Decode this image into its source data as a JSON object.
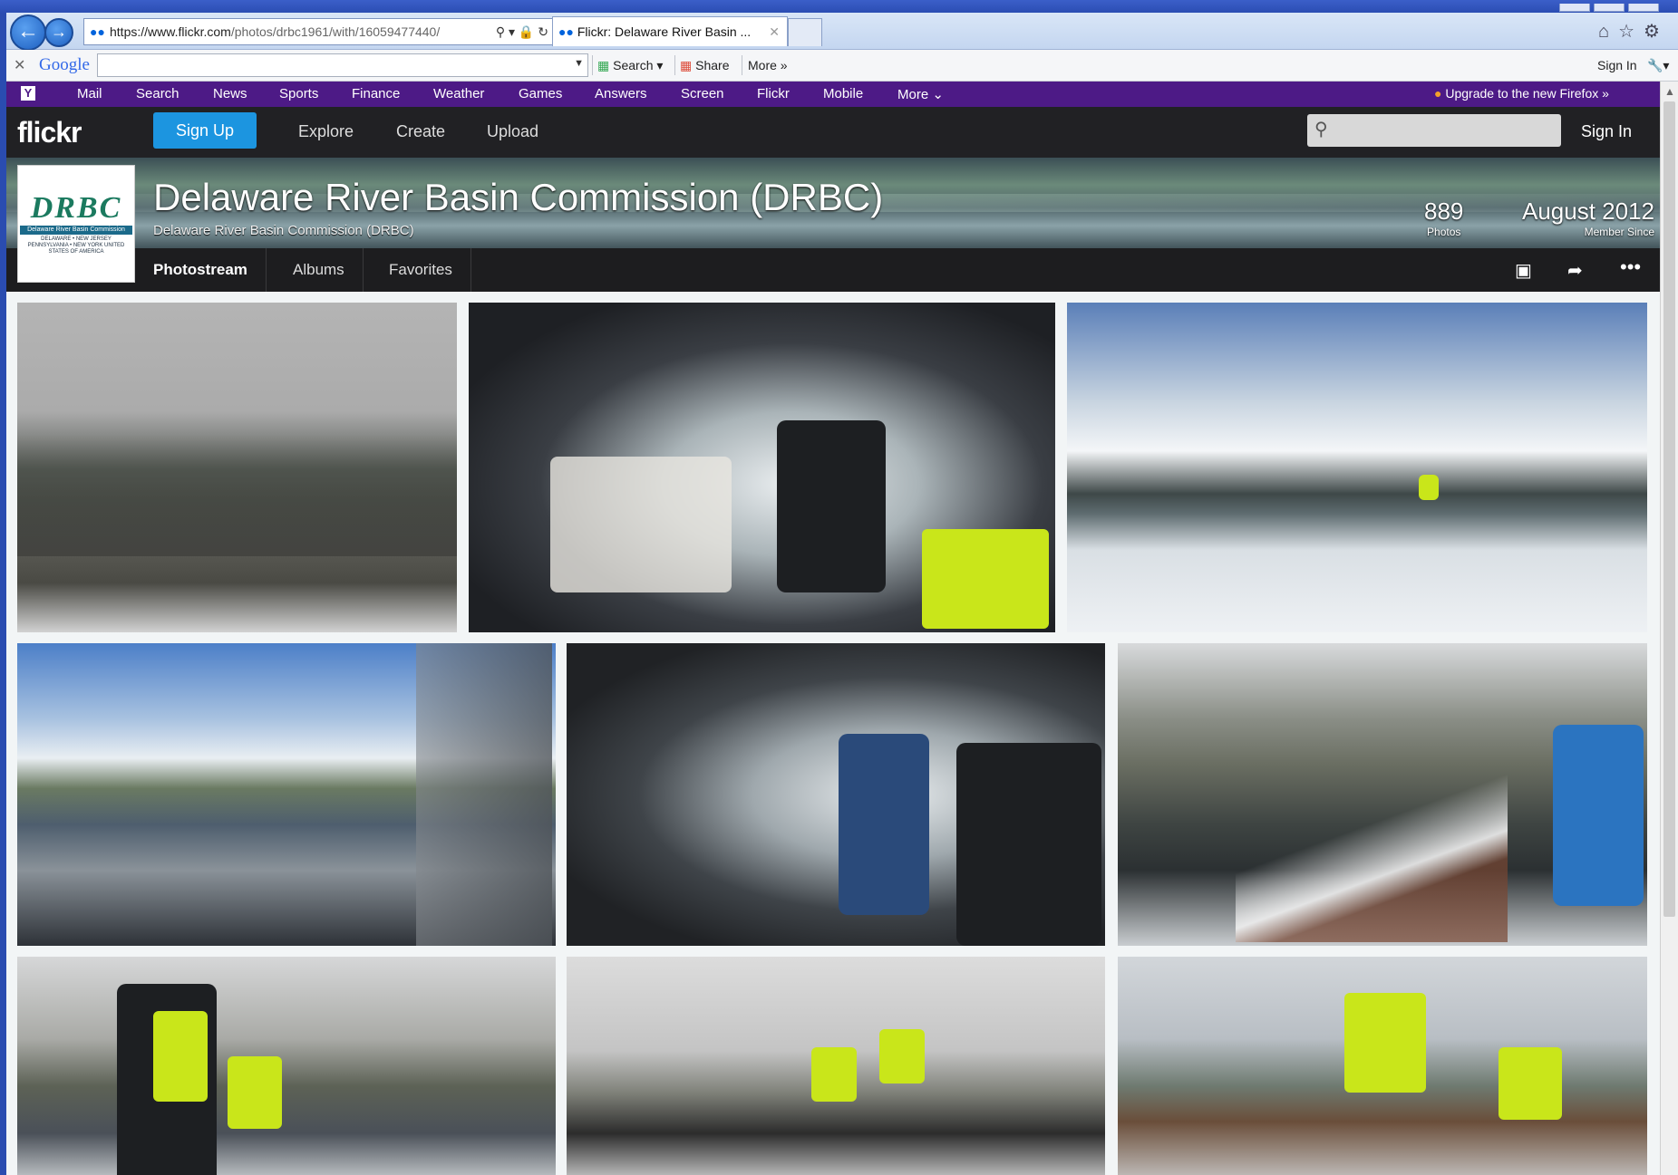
{
  "browser": {
    "url_scheme": "https://",
    "url_domain": "www.flickr.com",
    "url_path": "/photos/drbc1961/with/16059477440/",
    "tab_title": "Flickr: Delaware River Basin ..."
  },
  "google_toolbar": {
    "logo": "Google",
    "search_label": "Search",
    "share_label": "Share",
    "more_label": "More",
    "sign_in": "Sign In"
  },
  "yahoo_bar": {
    "links": [
      "Mail",
      "Search",
      "News",
      "Sports",
      "Finance",
      "Weather",
      "Games",
      "Answers",
      "Screen",
      "Flickr",
      "Mobile",
      "More"
    ],
    "upgrade": "Upgrade to the new Firefox »"
  },
  "flickr": {
    "logo": "flickr",
    "sign_up": "Sign Up",
    "nav": [
      "Explore",
      "Create",
      "Upload"
    ],
    "sign_in": "Sign In"
  },
  "profile": {
    "name": "Delaware River Basin Commission (DRBC)",
    "subname": "Delaware River Basin Commission (DRBC)",
    "photos_count": "889",
    "photos_label": "Photos",
    "member_since": "August 2012",
    "member_since_label": "Member Since",
    "avatar_logo": "DRBC",
    "avatar_band": "Delaware River Basin Commission",
    "avatar_small": "DELAWARE • NEW JERSEY PENNSYLVANIA • NEW YORK UNITED STATES OF AMERICA"
  },
  "subnav": {
    "tabs": [
      "Photostream",
      "Albums",
      "Favorites"
    ]
  },
  "icons": {
    "back": "back-arrow-icon",
    "forward": "forward-arrow-icon",
    "search": "search-icon",
    "slideshow": "slideshow-icon",
    "share": "share-icon",
    "more": "more-icon"
  }
}
